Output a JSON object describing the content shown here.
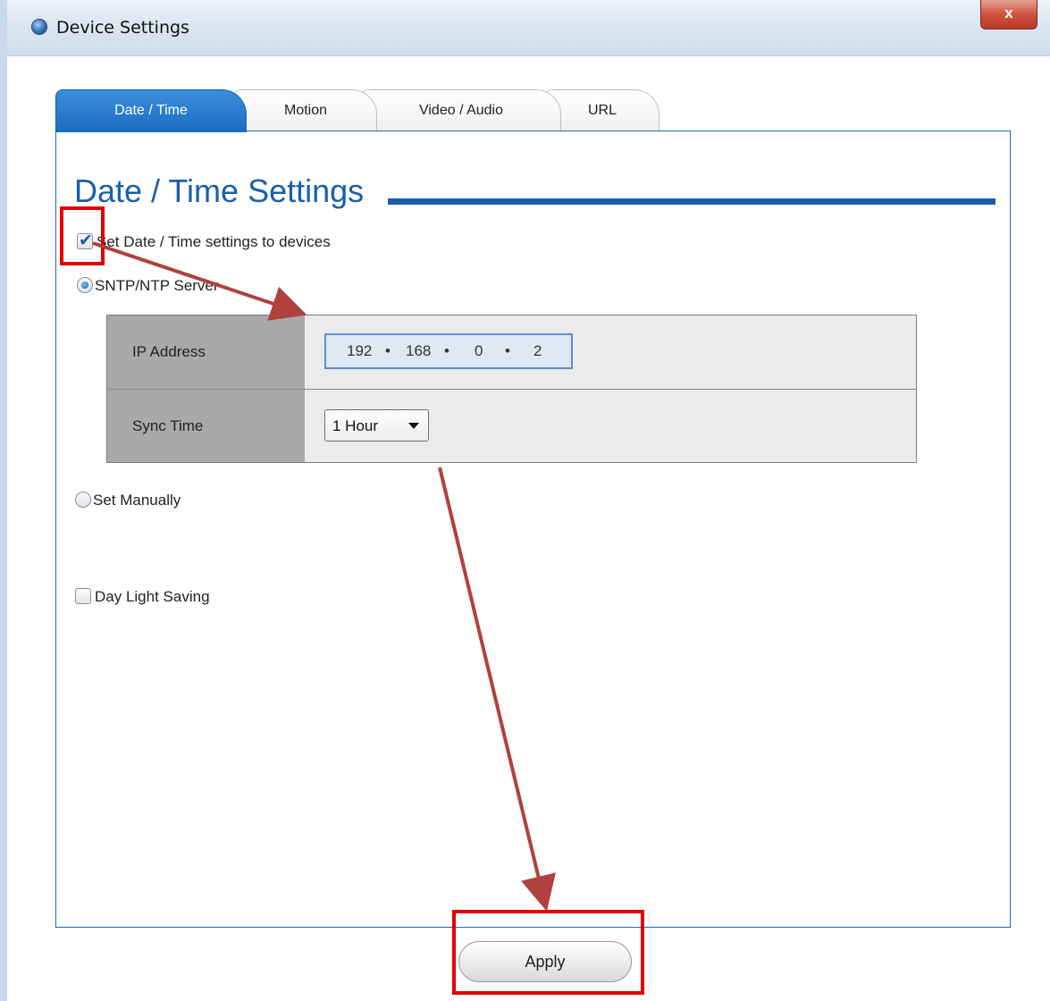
{
  "window": {
    "title": "Device Settings",
    "close_label": "x"
  },
  "tabs": [
    {
      "label": "Date / Time",
      "active": true
    },
    {
      "label": "Motion",
      "active": false
    },
    {
      "label": "Video / Audio",
      "active": false
    },
    {
      "label": "URL",
      "active": false
    }
  ],
  "section": {
    "title": "Date / Time Settings"
  },
  "options": {
    "set_to_devices": {
      "label": "Set Date / Time settings to devices",
      "checked": true
    },
    "sntp": {
      "label": "SNTP/NTP Server",
      "selected": true
    },
    "manual": {
      "label": "Set Manually",
      "selected": false
    },
    "daylight": {
      "label": "Day Light Saving",
      "checked": false
    }
  },
  "sntp_table": {
    "ip_label": "IP Address",
    "ip": [
      "192",
      "168",
      "0",
      "2"
    ],
    "sync_label": "Sync Time",
    "sync_value": "1 Hour"
  },
  "actions": {
    "apply_label": "Apply"
  },
  "colors": {
    "accent": "#1c5ca8",
    "annotation": "#e00000",
    "arrow": "#b0413e"
  }
}
